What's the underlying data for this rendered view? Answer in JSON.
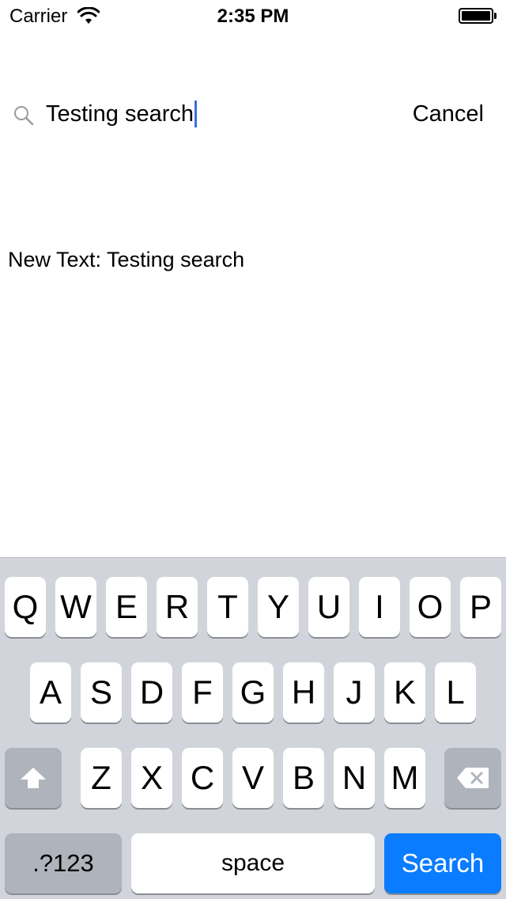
{
  "status_bar": {
    "carrier": "Carrier",
    "wifi_icon": "wifi-icon",
    "time": "2:35 PM",
    "battery_icon": "battery-icon",
    "battery_level": 1.0
  },
  "search": {
    "icon": "search-icon",
    "value": "Testing search",
    "cancel_label": "Cancel"
  },
  "result": {
    "text": "New Text: Testing search"
  },
  "keyboard": {
    "row1": [
      "Q",
      "W",
      "E",
      "R",
      "T",
      "Y",
      "U",
      "I",
      "O",
      "P"
    ],
    "row2": [
      "A",
      "S",
      "D",
      "F",
      "G",
      "H",
      "J",
      "K",
      "L"
    ],
    "row3": [
      "Z",
      "X",
      "C",
      "V",
      "B",
      "N",
      "M"
    ],
    "shift_icon": "shift-arrow-icon",
    "delete_icon": "backspace-icon",
    "numbers_label": ".?123",
    "space_label": "space",
    "search_label": "Search",
    "search_key_color": "#0a7cff"
  }
}
